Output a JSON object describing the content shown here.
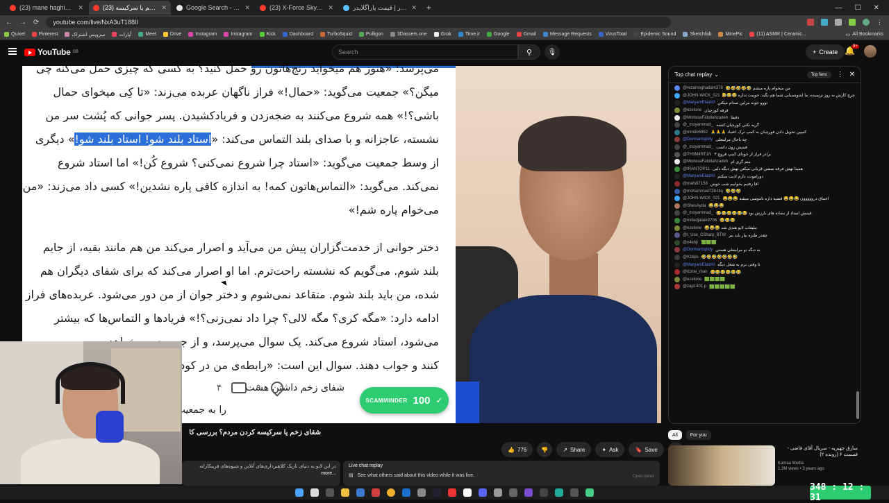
{
  "browser": {
    "tabs": [
      {
        "title": "(23) mane haghigh - YouTube",
        "active": false
      },
      {
        "title": "(23) شفای زخم یا سرکیسه",
        "active": true
      },
      {
        "title": "Google Search - قزال فورچیان",
        "active": false
      },
      {
        "title": "(23) X-Force Skydiving - Brad",
        "active": false
      },
      {
        "title": "خرید پاراگلایدر | قیمت پاراگلایدر",
        "active": false
      }
    ],
    "url": "youtube.com/live/NxA3uT188II",
    "bookmarks": [
      "Quixel",
      "Pinterest",
      "سرویس اشتراک",
      "آپارات",
      "Meet",
      "Drive",
      "Instagram",
      "Instagram",
      "Kick",
      "Dashboard",
      "TurboSquid",
      "Poliigon",
      "3Dassets.one",
      "Grok",
      "Time.ir",
      "Google",
      "Gmail",
      "Message Requests",
      "VirusTotal",
      "Epidemic Sound",
      "Sketchfab",
      "MinePic",
      "(11) ASMR | Ceramic..."
    ],
    "all_bookmarks": "All Bookmarks"
  },
  "youtube": {
    "logo": "YouTube",
    "logo_region": "GB",
    "search_placeholder": "Search",
    "create_label": "Create",
    "notif_badge": "9+"
  },
  "document": {
    "lines": [
      "می‌پرسد: «هنوز هم میخواید رنج‌هاتون رو حمل کنید؟ به کسی که چیزی حمل می‌کنه چی",
      "میگن؟» جمعیت می‌گوید: «حمال!» فراز ناگهان عربده می‌زند: «تا کِی میخوای حمال",
      "باشی؟!» همه شروع می‌کنند به ضجه‌زدن و فریادکشیدن. پسر جوانی که پُشت سر من",
      "نشسته، عاجزانه و با صدای بلند التماس می‌کند: «",
      "از وسط جمعیت می‌گوید: «استاد چرا شروع نمی‌کنی؟ شروع کُن!» اما استاد شروع",
      "نمی‌کند. می‌گوید: «التماس‌هاتون کمه! به اندازه کافی پاره نشدین!» کسی داد می‌زند: «من",
      "می‌خوام پاره شم!»",
      "دختر جوانی از خدمت‌گزاران پیش من می‌آید و اصرار می‌کند من هم مانند بقیه، از جایم",
      "بلند شوم. می‌گویم که نشسته راحت‌ترم. اما او اصرار می‌کند که برای شفای دیگران هم",
      "شده، من باید بلند شوم. متقاعد نمی‌شوم و دختر جوان از من دور می‌شود. عربده‌های فراز",
      "ادامه دارد: «مگه کری؟ مگه لالی؟ چرا داد نمی‌زنی؟!» فریادها و التماس‌ها که بیشتر",
      "می‌شود، استاد شروع می‌کند. یک سوال می‌پرسد، و از جمعیت می‌خواهد",
      "کنند و جواب دهند. سوال این است: «رابطه‌ی من در کودکی"
    ],
    "highlight": "استاد بلند شو! استاد بلند شو!",
    "line4_suffix": "» دیگری",
    "partial_line": "شفای زخم داشتن هست",
    "bottom_line": "را به جمعیت القا می‌کند: «بنویس که در کو",
    "like_count": "۹",
    "comment_count": "۴"
  },
  "overlay": {
    "label": "SCAMMINDER",
    "score": "100"
  },
  "video": {
    "title": "شفای زخم یا سرکیسه کردن مردم؟ بررسی کا",
    "likes": "776",
    "share": "Share",
    "ask": "Ask",
    "save": "Save",
    "description": "در این لایو به دنیای تاریک کلاهبرداری‌های آنلاین و شیوه‌های فریبکارانه",
    "more": "...more"
  },
  "live_replay": {
    "title": "Live chat replay",
    "subtitle": "See what others said about this video while it was live.",
    "open_panel": "Open panel"
  },
  "chat": {
    "header": "Top chat replay",
    "top_fans": "Top fans",
    "messages": [
      {
        "author": "@rezamoghadam378",
        "text": "من میخوام پاره میشم 🤣🤣🤣🤣🤣",
        "color": "#5e84f1",
        "mod": false
      },
      {
        "author": "@JOHN-WICK_021",
        "text": "چرچ کارش به روز نرسیده، ما اینتونسیایی شما هم بگید، خوبیت نداره 😂😂😂",
        "color": "#3ea6ff",
        "mod": false
      },
      {
        "author": "@MaryamElash0",
        "text": "تووو خونه مرلین صدام میکنن",
        "color": "#222222",
        "mod": true
      },
      {
        "author": "@ezelone",
        "text": "قرقه کوزچیان",
        "color": "#7b8b3a",
        "mod": false
      },
      {
        "author": "@MorteзaFatollahzadeh",
        "text": "دقیقاً",
        "color": "#eeeeee",
        "mod": false
      },
      {
        "author": "@_moyammad_",
        "text": "گریه نکنی کوزچیان کنشه",
        "color": "#444444",
        "mod": false
      },
      {
        "author": "@mmdo5952",
        "text": "کمپین تحویل دادن قوزچیان به کمپ ترک اعتیاد 🙏🙏🙏",
        "color": "#2a7a8a",
        "mod": false
      },
      {
        "author": "@Dormantspidy",
        "text": "چه باحال مرلینعلی",
        "color": "#8a3a3a",
        "mod": true
      },
      {
        "author": "@_moyammad_",
        "text": "قیتیش زون داشت",
        "color": "#444444",
        "mod": false
      },
      {
        "author": "@TH3M4RT1N",
        "text": "برادر فراز از خودای کمپ فروچ ۳",
        "color": "#555555",
        "mod": false
      },
      {
        "author": "@MorteзaFatollahzadeh",
        "text": "منم گری ام",
        "color": "#eeeeee",
        "mod": false
      },
      {
        "author": "@IRANTOP11",
        "text": "همینا تهش فرقه میشن قربانی میکنن تهش دیگه دلیی",
        "color": "#3a8a3a",
        "mod": false
      },
      {
        "author": "@MaryamElash0",
        "text": "دوراموت، دارم اذیت میکنم",
        "color": "#222222",
        "mod": true
      },
      {
        "author": "@mahdi7158",
        "text": "آقا رفتیم بخوابیم شب خوش",
        "color": "#8a2a2a",
        "mod": false
      },
      {
        "author": "@mohammad738-l3q",
        "text": "🤣🤣🤣",
        "color": "#3a5aaa",
        "mod": false
      },
      {
        "author": "@JOHN-WICK_021",
        "text": "اعماق درووووون 😂😂😂 قصیه داره ناموسی میشه 😂😂😂",
        "color": "#3ea6ff",
        "mod": false
      },
      {
        "author": "@ShesAyda",
        "text": "😂😂😂",
        "color": "#aa7a5a",
        "mod": false
      },
      {
        "author": "@_moyammad_",
        "text": "قیتیش استاد از نشانه های بارزش بود 😂😂😂😂😂😂",
        "color": "#444444",
        "mod": false
      },
      {
        "author": "@milladjalale9706",
        "text": "😂😂😂",
        "color": "#3a8a3a",
        "mod": false
      },
      {
        "author": "@ezelone",
        "text": "تبلیغات لایو هندی شد 😂😂😂",
        "color": "#7b8b3a",
        "mod": false
      },
      {
        "author": "@I_Use_CSharp_BTW",
        "text": "چقدر طنزه بیار باید بیر",
        "color": "#5a5a8a",
        "mod": false
      },
      {
        "author": "@n4khjr",
        "text": "🟩🟩🟩",
        "color": "#2a4a2a",
        "mod": false
      },
      {
        "author": "@Dormantspidy",
        "text": "نه دیگه تو مرلینعلی هستی",
        "color": "#8a3a3a",
        "mod": true
      },
      {
        "author": "@K1tips",
        "text": "🤣🤣🤣🤣🤣🤣🤣",
        "color": "#3a3a3a",
        "mod": false
      },
      {
        "author": "@MaryamElash0",
        "text": "تا وقتی برم به شغل دیگه",
        "color": "#222222",
        "mod": true
      },
      {
        "author": "@itzme_man",
        "text": "😂😂😂😂😂😂",
        "color": "#aa2a2a",
        "mod": false
      },
      {
        "author": "@ezelone",
        "text": "🟩🟩🟩🟩",
        "color": "#7b8b3a",
        "mod": false
      },
      {
        "author": "@zap1401.p",
        "text": "🟩🟩🟩🟩🟩",
        "color": "#aa3a3a",
        "mod": false
      }
    ]
  },
  "sidebar": {
    "chips": [
      "All",
      "For you"
    ],
    "rec_title": "سارق جهیزیه - سریال آقای قاضی - قسمت ۶ (رونده ۲)",
    "rec_channel": "Kamaa Media",
    "rec_meta": "1.3M views • 3 years ago"
  },
  "timer": "348 : 12 : 31"
}
